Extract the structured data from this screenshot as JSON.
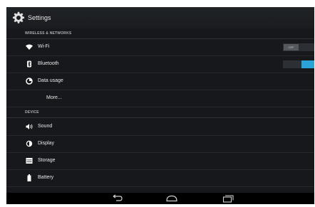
{
  "action_bar": {
    "title": "Settings",
    "icon": "gear-icon"
  },
  "sections": {
    "wireless": "WIRELESS & NETWORKS",
    "device": "DEVICE"
  },
  "items": {
    "wifi": {
      "label": "Wi-Fi",
      "icon": "wifi-icon",
      "toggle": "OFF"
    },
    "bluetooth": {
      "label": "Bluetooth",
      "icon": "bluetooth-icon",
      "toggle": "ON"
    },
    "data_usage": {
      "label": "Data usage",
      "icon": "data-usage-icon"
    },
    "more": {
      "label": "More..."
    },
    "sound": {
      "label": "Sound",
      "icon": "speaker-icon"
    },
    "display": {
      "label": "Display",
      "icon": "brightness-icon"
    },
    "storage": {
      "label": "Storage",
      "icon": "storage-icon"
    },
    "battery": {
      "label": "Battery",
      "icon": "battery-icon"
    }
  },
  "nav_bar": {
    "buttons": [
      "back-icon",
      "home-icon",
      "recents-icon"
    ]
  },
  "colors": {
    "accent": "#2aa3d8",
    "background": "#16181b"
  }
}
